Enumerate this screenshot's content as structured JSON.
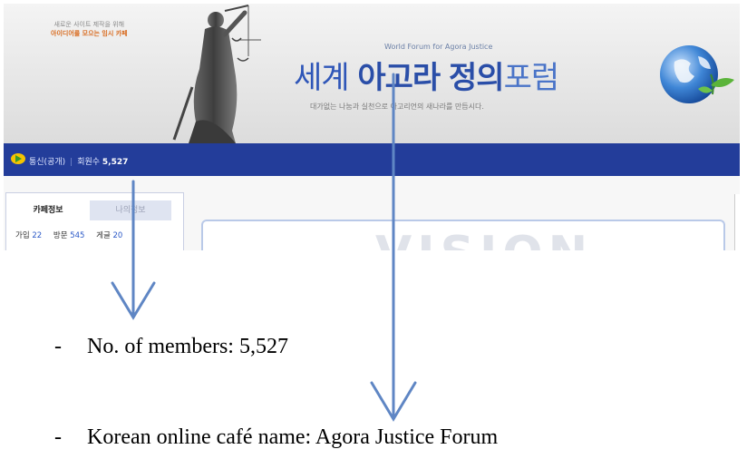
{
  "banner": {
    "tagline_line1": "새로운 사이트 제작을 위해",
    "tagline_line2": "아이디어를 모으는 임시 카페",
    "title_en": "World Forum for Agora Justice",
    "title_ko_part1": "세계",
    "title_ko_part2": "아고라",
    "title_ko_part3": "정의",
    "title_ko_part4": "포럼",
    "subtitle_ko": "대가없는 나눔과 실천으로 아고리언의 새나라를 만듭시다."
  },
  "navbar": {
    "status_label": "통신(공개)",
    "members_label": "회원수",
    "members_count": "5,527"
  },
  "left_panel": {
    "tabs": [
      {
        "label": "카페정보"
      },
      {
        "label": "나의정보"
      }
    ],
    "stats": [
      {
        "label": "가입",
        "value": "22"
      },
      {
        "label": "방문",
        "value": "545"
      },
      {
        "label": "게글",
        "value": "20"
      }
    ]
  },
  "main": {
    "vision_text": "VISION"
  },
  "annotations": {
    "line1": "No. of members: 5,527",
    "line2": "Korean online café name: Agora Justice Forum"
  },
  "colors": {
    "navbar": "#233d9a",
    "title_blue": "#2a4ea8",
    "arrow": "#5f86c4",
    "tagline_orange": "#d86a1e"
  }
}
